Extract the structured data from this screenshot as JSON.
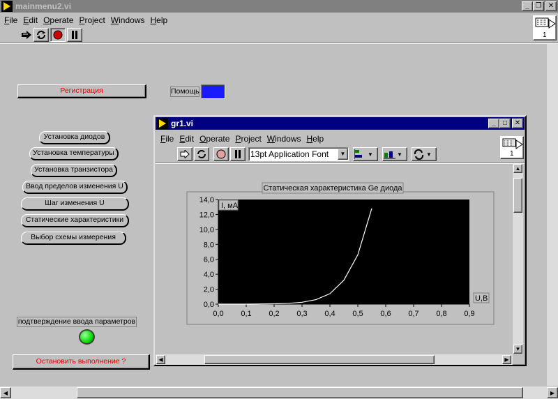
{
  "main_window": {
    "title": "mainmenu2.vi",
    "menus": [
      "File",
      "Edit",
      "Operate",
      "Project",
      "Windows",
      "Help"
    ],
    "icon_label": "1"
  },
  "panel": {
    "register_label": "Регистрация",
    "help_label": "Помощь",
    "help_color": "#1a1aff",
    "buttons": [
      "Установка диодов",
      "Установка температуры",
      "Установка транзистора",
      "Ввод пределов изменения U",
      "Шаг изменения U",
      "Статические характеристики",
      "Выбор схемы измерения"
    ],
    "confirm_label": "подтверждение ввода параметров",
    "led_color": "#00e000",
    "stop_label": "Остановить выполнение ?"
  },
  "sub_window": {
    "title": "gr1.vi",
    "menus": [
      "File",
      "Edit",
      "Operate",
      "Project",
      "Windows",
      "Help"
    ],
    "font_select": "13pt Application Font",
    "icon_label": "1"
  },
  "chart_data": {
    "type": "line",
    "title": "Статическая характеристика Ge диода",
    "ylabel": "I, мА",
    "xlabel": "U,В",
    "xlim": [
      0,
      0.9
    ],
    "ylim": [
      0,
      14
    ],
    "xticks": [
      "0,0",
      "0,1",
      "0,2",
      "0,3",
      "0,4",
      "0,5",
      "0,6",
      "0,7",
      "0,8",
      "0,9"
    ],
    "yticks": [
      "0,0",
      "2,0",
      "4,0",
      "6,0",
      "8,0",
      "10,0",
      "12,0",
      "14,0"
    ],
    "x": [
      0,
      0.05,
      0.1,
      0.15,
      0.2,
      0.25,
      0.3,
      0.35,
      0.4,
      0.45,
      0.5,
      0.55
    ],
    "y": [
      0,
      0,
      0,
      0.02,
      0.05,
      0.1,
      0.25,
      0.6,
      1.4,
      3.2,
      6.6,
      12.8
    ],
    "plot_bg": "#000000",
    "line_color": "#ffffff"
  }
}
